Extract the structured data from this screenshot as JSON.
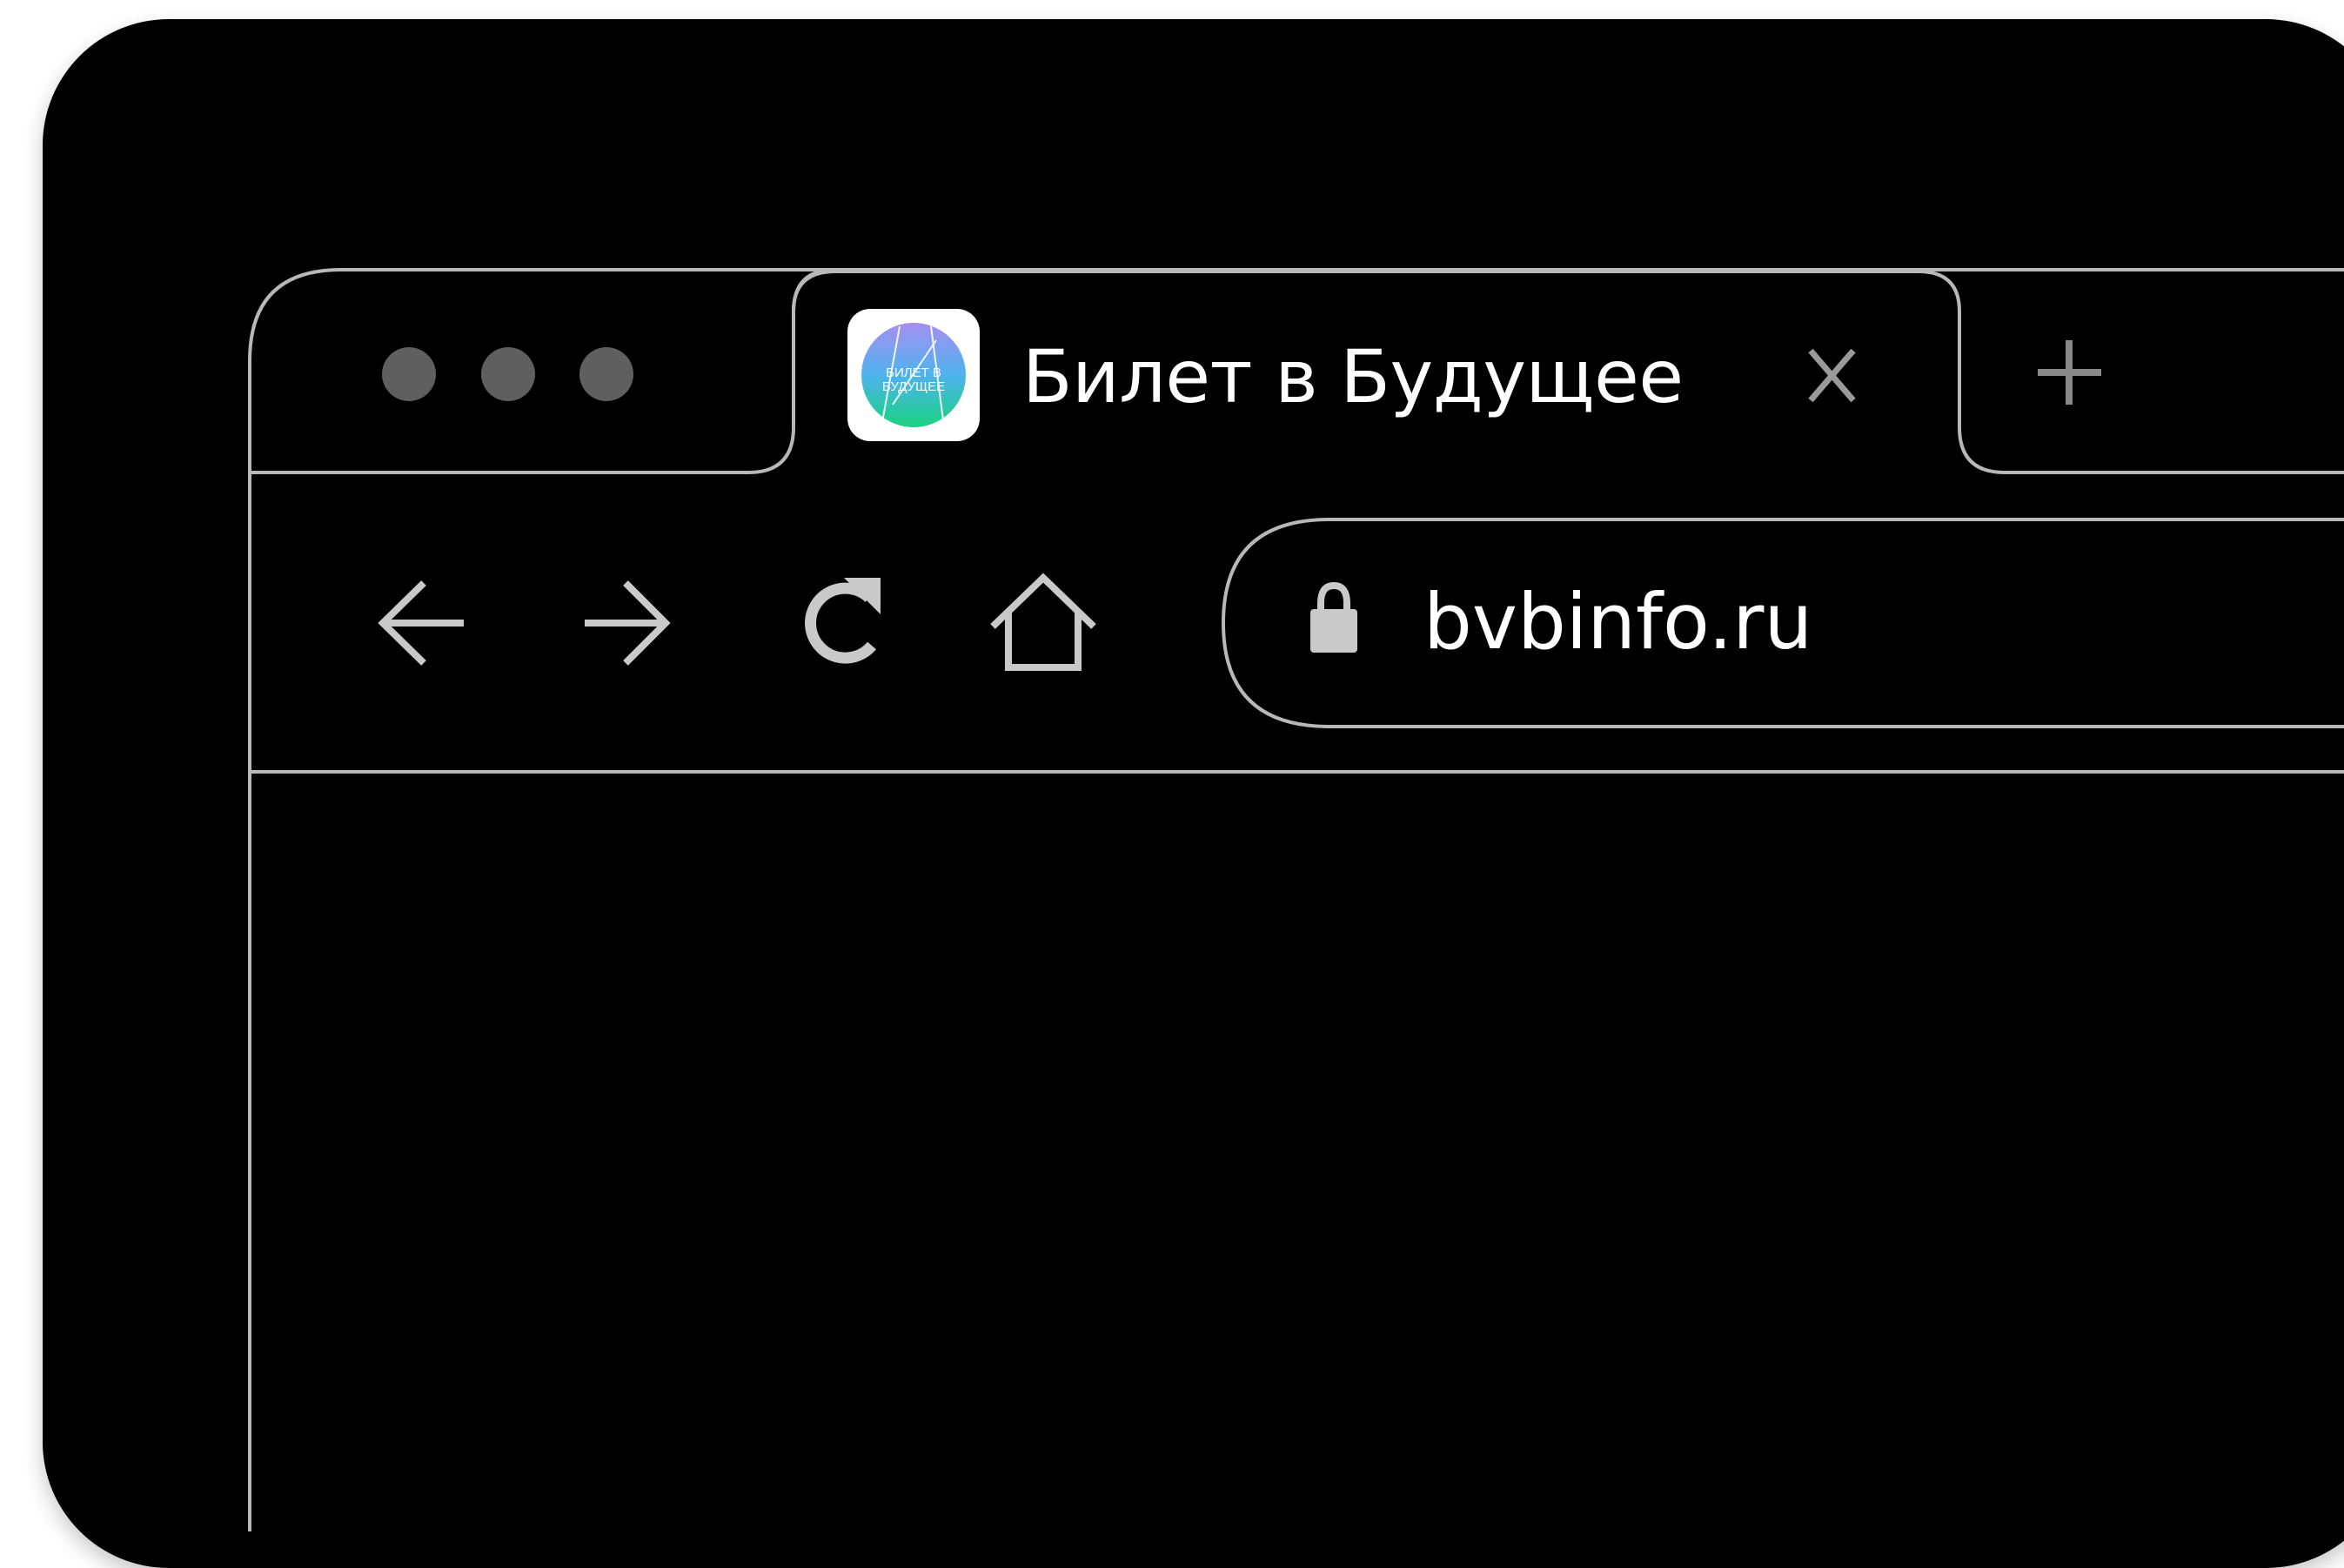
{
  "window": {
    "colors": {
      "background": "#000000",
      "outline": "#b8b8b8",
      "dot": "#5f5f5f",
      "icon": "#c9c9c9",
      "text": "#ffffff"
    },
    "traffic_lights": [
      "dot",
      "dot",
      "dot"
    ]
  },
  "tab": {
    "title": "Билет в Будущее",
    "favicon_icon": "bilet-v-budushchee-logo-icon",
    "favicon_text": "БИЛЕТ В БУДУЩЕЕ",
    "close_icon": "close-icon"
  },
  "new_tab": {
    "icon": "plus-icon"
  },
  "toolbar": {
    "back_icon": "arrow-left-icon",
    "forward_icon": "arrow-right-icon",
    "reload_icon": "reload-icon",
    "home_icon": "home-icon"
  },
  "address_bar": {
    "lock_icon": "lock-icon",
    "url": "bvbinfo.ru"
  }
}
